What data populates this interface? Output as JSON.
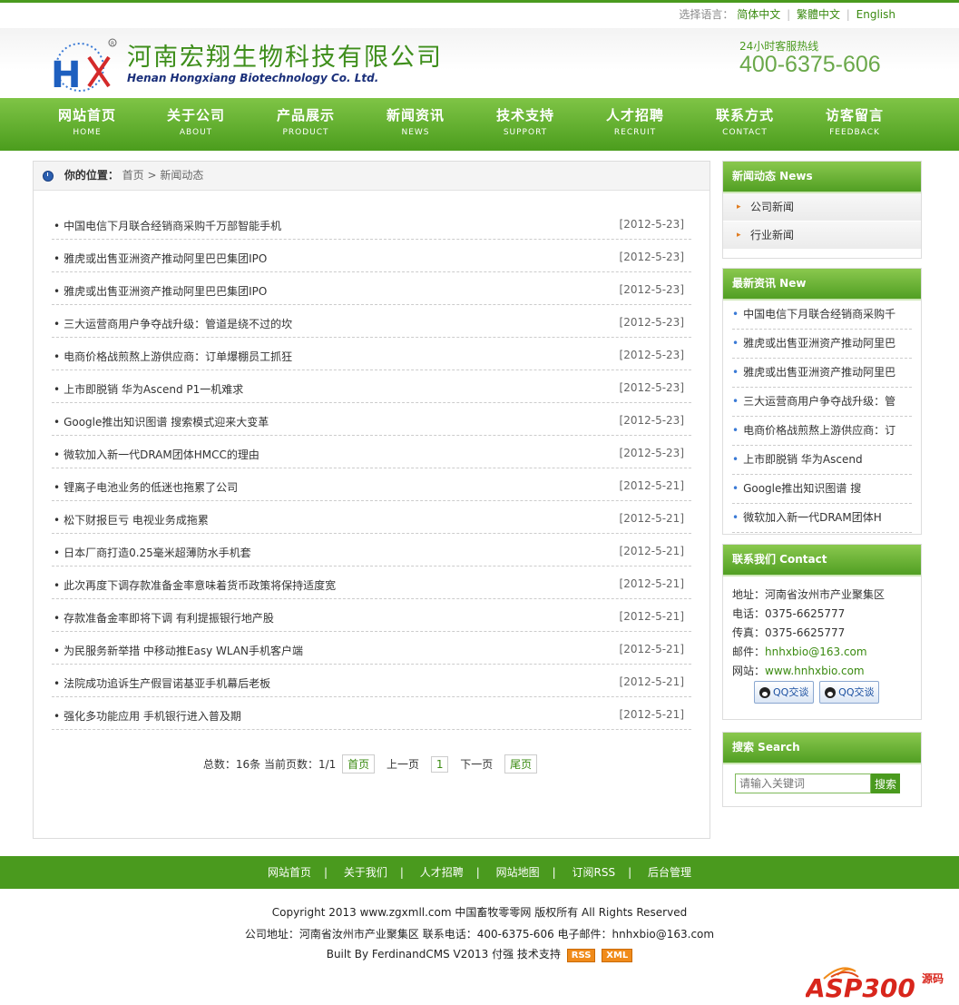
{
  "lang": {
    "label": "选择语言：",
    "opts": [
      "简体中文",
      "繁體中文",
      "English"
    ]
  },
  "header": {
    "company_cn": "河南宏翔生物科技有限公司",
    "company_en": "Henan Hongxiang Biotechnology Co. Ltd.",
    "hotline_label": "24小时客服热线",
    "hotline": "400-6375-606"
  },
  "nav": [
    {
      "cn": "网站首页",
      "en": "HOME"
    },
    {
      "cn": "关于公司",
      "en": "ABOUT"
    },
    {
      "cn": "产品展示",
      "en": "PRODUCT"
    },
    {
      "cn": "新闻资讯",
      "en": "NEWS"
    },
    {
      "cn": "技术支持",
      "en": "SUPPORT"
    },
    {
      "cn": "人才招聘",
      "en": "RECRUIT"
    },
    {
      "cn": "联系方式",
      "en": "CONTACT"
    },
    {
      "cn": "访客留言",
      "en": "FEEDBACK"
    }
  ],
  "breadcrumb": {
    "label": "你的位置：",
    "home": "首页",
    "current": "> 新闻动态"
  },
  "news": [
    {
      "title": "中国电信下月联合经销商采购千万部智能手机",
      "date": "[2012-5-23]"
    },
    {
      "title": "雅虎或出售亚洲资产推动阿里巴巴集团IPO",
      "date": "[2012-5-23]"
    },
    {
      "title": "雅虎或出售亚洲资产推动阿里巴巴集团IPO",
      "date": "[2012-5-23]"
    },
    {
      "title": "三大运营商用户争夺战升级：管道是绕不过的坎",
      "date": "[2012-5-23]"
    },
    {
      "title": "电商价格战煎熬上游供应商：订单爆棚员工抓狂",
      "date": "[2012-5-23]"
    },
    {
      "title": "上市即脱销 华为Ascend P1一机难求",
      "date": "[2012-5-23]"
    },
    {
      "title": "Google推出知识图谱 搜索模式迎来大变革",
      "date": "[2012-5-23]"
    },
    {
      "title": "微软加入新一代DRAM团体HMCC的理由",
      "date": "[2012-5-23]"
    },
    {
      "title": "锂离子电池业务的低迷也拖累了公司",
      "date": "[2012-5-21]"
    },
    {
      "title": "松下财报巨亏 电视业务成拖累",
      "date": "[2012-5-21]"
    },
    {
      "title": "日本厂商打造0.25毫米超薄防水手机套",
      "date": "[2012-5-21]"
    },
    {
      "title": "此次再度下调存款准备金率意味着货币政策将保持适度宽",
      "date": "[2012-5-21]"
    },
    {
      "title": "存款准备金率即将下调 有利提振银行地产股",
      "date": "[2012-5-21]"
    },
    {
      "title": "为民服务新举措 中移动推Easy WLAN手机客户端",
      "date": "[2012-5-21]"
    },
    {
      "title": "法院成功追诉生产假冒诺基亚手机幕后老板",
      "date": "[2012-5-21]"
    },
    {
      "title": "强化多功能应用 手机银行进入普及期",
      "date": "[2012-5-21]"
    }
  ],
  "pager": {
    "total": "总数：16条",
    "current": "当前页数：1/1",
    "first": "首页",
    "prev": "上一页",
    "page": "1",
    "next": "下一页",
    "last": "尾页"
  },
  "side": {
    "cat_title": "新闻动态  News",
    "cats": [
      "公司新闻",
      "行业新闻"
    ],
    "latest_title": "最新资讯  New",
    "latest": [
      "中国电信下月联合经销商采购千",
      "雅虎或出售亚洲资产推动阿里巴",
      "雅虎或出售亚洲资产推动阿里巴",
      "三大运营商用户争夺战升级：管",
      "电商价格战煎熬上游供应商：订",
      "上市即脱销 华为Ascend",
      "Google推出知识图谱 搜",
      "微软加入新一代DRAM团体H"
    ],
    "contact_title": "联系我们  Contact",
    "contact": {
      "addr": "地址：河南省汝州市产业聚集区",
      "tel": "电话：0375-6625777",
      "fax": "传真：0375-6625777",
      "mail_label": "邮件：",
      "mail": "hnhxbio@163.com",
      "web_label": "网站：",
      "web": "www.hnhxbio.com",
      "qq": "QQ交谈"
    },
    "search_title": "搜索  Search",
    "search_placeholder": "请输入关键词",
    "search_btn": "搜索"
  },
  "footer_nav": [
    "网站首页",
    "关于我们",
    "人才招聘",
    "网站地图",
    "订阅RSS",
    "后台管理"
  ],
  "footer": {
    "copyright": "Copyright 2013 www.zgxmll.com 中国畜牧零零网  版权所有  All Rights Reserved",
    "info": "公司地址：河南省汝州市产业聚集区  联系电话：400-6375-606 电子邮件：hnhxbio@163.com",
    "built": "Built By FerdinandCMS V2013 付强  技术支持",
    "rss": "RSS",
    "xml": "XML"
  },
  "brand": {
    "text": "ASP300",
    "sub": "源码"
  },
  "colors": {
    "accent": "#4a9a1e",
    "title_green": "#3e8e1b"
  }
}
